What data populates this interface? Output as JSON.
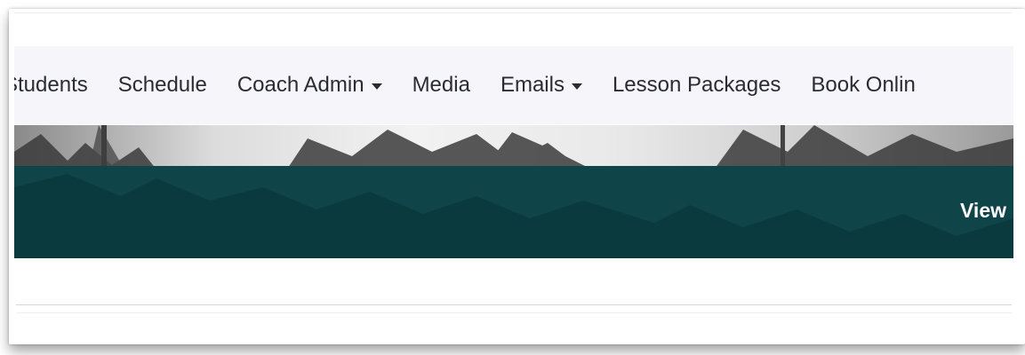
{
  "navbar": {
    "items": [
      {
        "label": "Students",
        "has_dropdown": false
      },
      {
        "label": "Schedule",
        "has_dropdown": false
      },
      {
        "label": "Coach Admin",
        "has_dropdown": true
      },
      {
        "label": "Media",
        "has_dropdown": false
      },
      {
        "label": "Emails",
        "has_dropdown": true
      },
      {
        "label": "Lesson Packages",
        "has_dropdown": false
      },
      {
        "label": "Book Onlin",
        "has_dropdown": false
      }
    ]
  },
  "hero": {
    "cta_label": "View",
    "band_color": "#0f4448"
  },
  "colors": {
    "nav_background": "#f6f6fa",
    "nav_text": "#2b2b33"
  }
}
